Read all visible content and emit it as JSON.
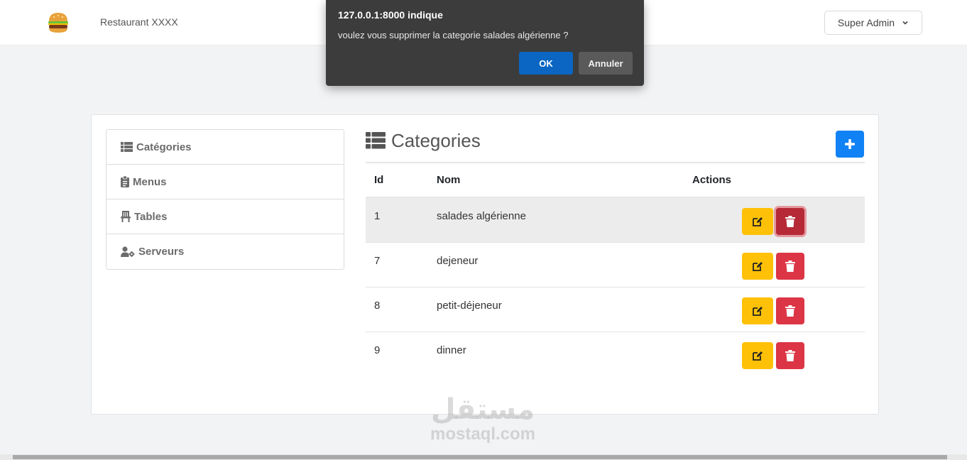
{
  "header": {
    "brand": "Restaurant XXXX",
    "logo_icon": "burger-icon",
    "user_menu_label": "Super Admin"
  },
  "sidebar": {
    "items": [
      {
        "label": "Catégories",
        "icon": "list-icon"
      },
      {
        "label": "Menus",
        "icon": "clipboard-icon"
      },
      {
        "label": "Tables",
        "icon": "chair-icon"
      },
      {
        "label": "Serveurs",
        "icon": "user-cog-icon"
      }
    ]
  },
  "main": {
    "title": "Categories",
    "add_icon": "plus-icon",
    "columns": [
      "Id",
      "Nom",
      "Actions"
    ],
    "rows": [
      {
        "id": "1",
        "nom": "salades algérienne"
      },
      {
        "id": "7",
        "nom": "dejeneur"
      },
      {
        "id": "8",
        "nom": "petit-déjeneur"
      },
      {
        "id": "9",
        "nom": "dinner"
      }
    ]
  },
  "dialog": {
    "origin": "127.0.0.1:8000 indique",
    "message": "voulez vous supprimer la categorie salades algérienne ?",
    "ok_label": "OK",
    "cancel_label": "Annuler"
  },
  "watermark": {
    "arabic": "مستقل",
    "latin": "mostaql.com"
  },
  "colors": {
    "primary": "#1182f5",
    "warning": "#ffc107",
    "danger": "#dc3545",
    "dialog_ok": "#0a66c2"
  }
}
